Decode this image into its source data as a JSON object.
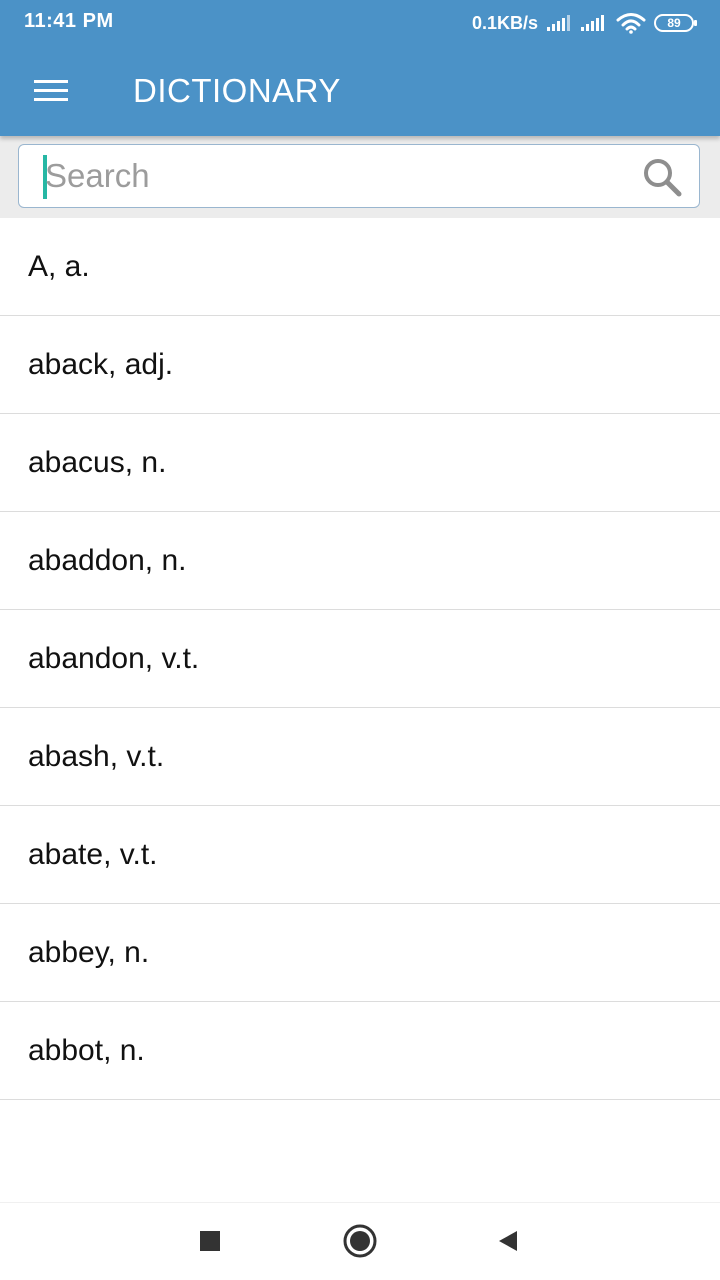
{
  "status_bar": {
    "time": "11:41 PM",
    "network_speed": "0.1KB/s",
    "battery_level": "89"
  },
  "toolbar": {
    "title": "DICTIONARY",
    "menu_icon": "hamburger-menu-icon"
  },
  "search": {
    "placeholder": "Search",
    "value": "",
    "icon": "search-icon"
  },
  "words": [
    "A, a.",
    "aback, adj.",
    "abacus, n.",
    "abaddon, n.",
    "abandon, v.t.",
    "abash, v.t.",
    "abate, v.t.",
    "abbey, n.",
    "abbot, n."
  ],
  "nav_bar": {
    "recent_icon": "square-recents-icon",
    "home_icon": "circle-home-icon",
    "back_icon": "triangle-back-icon"
  },
  "colors": {
    "app_bar": "#4b92c7",
    "caret_accent": "#26b7a4",
    "search_area_bg": "#ececec",
    "divider": "#dcdcdc"
  }
}
